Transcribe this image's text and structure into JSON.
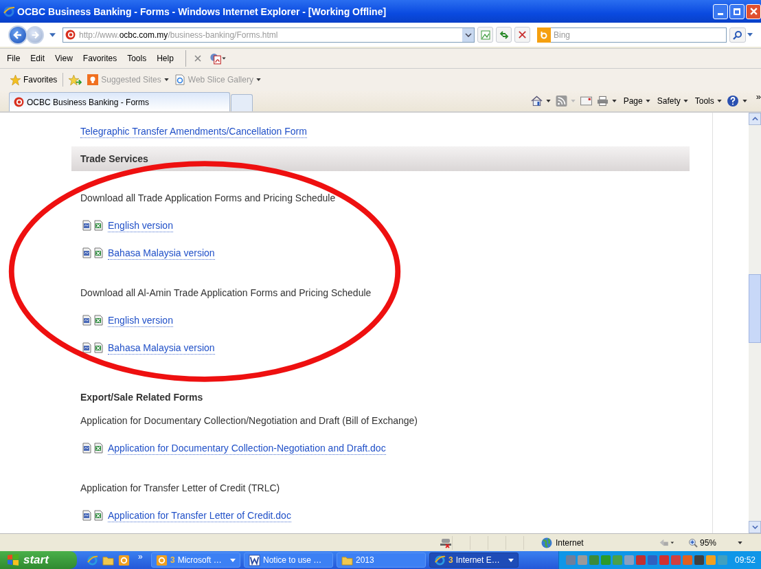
{
  "window": {
    "title": "OCBC Business Banking - Forms - Windows Internet Explorer - [Working Offline]"
  },
  "address": {
    "prefix": "http://www.",
    "domain": "ocbc.com.my",
    "path": "/business-banking/Forms.html"
  },
  "search": {
    "placeholder": "Bing"
  },
  "menu": [
    "File",
    "Edit",
    "View",
    "Favorites",
    "Tools",
    "Help"
  ],
  "favorites_bar": {
    "label": "Favorites",
    "links": [
      "Suggested Sites",
      "Web Slice Gallery"
    ]
  },
  "tabs": [
    {
      "label": "OCBC Business Banking - Forms",
      "selected": true
    }
  ],
  "command_bar": [
    "Page",
    "Safety",
    "Tools"
  ],
  "command_more": "»",
  "content": [
    {
      "kind": "link",
      "text": "Telegraphic Transfer Amendments/Cancellation Form"
    },
    {
      "kind": "section",
      "text": "Trade Services"
    },
    {
      "kind": "text",
      "text": "Download all Trade Application Forms and Pricing Schedule"
    },
    {
      "kind": "file",
      "text": "English version"
    },
    {
      "kind": "file",
      "text": "Bahasa Malaysia version"
    },
    {
      "kind": "text",
      "text": "Download all Al-Amin Trade Application Forms and Pricing Schedule"
    },
    {
      "kind": "file",
      "text": "English version"
    },
    {
      "kind": "file",
      "text": "Bahasa Malaysia version"
    },
    {
      "kind": "heading",
      "text": "Export/Sale Related Forms"
    },
    {
      "kind": "text",
      "text": "Application for Documentary Collection/Negotiation and Draft (Bill of Exchange)"
    },
    {
      "kind": "file",
      "text": "Application for Documentary Collection-Negotiation and Draft.doc"
    },
    {
      "kind": "text",
      "text": "Application for Transfer Letter of Credit (TRLC)"
    },
    {
      "kind": "file",
      "text": "Application for Transfer Letter of Credit.doc"
    }
  ],
  "status_bar": {
    "zone": "Internet",
    "zoom": "95%"
  },
  "taskbar": {
    "start": "start",
    "more": "»",
    "tasks": [
      {
        "count": "3",
        "label": "Microsoft …",
        "selected": false
      },
      {
        "label": "Notice to use …",
        "selected": false
      },
      {
        "label": "2013",
        "selected": false
      },
      {
        "count": "3",
        "label": "Internet E…",
        "selected": true
      }
    ],
    "clock": "09:52"
  }
}
